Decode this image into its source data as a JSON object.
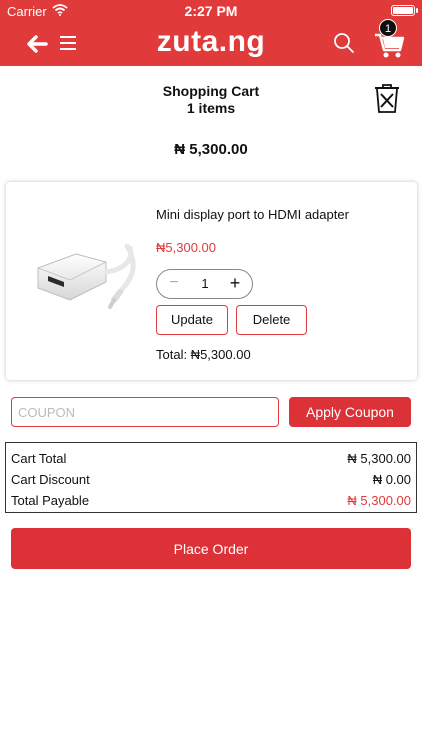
{
  "status_bar": {
    "carrier": "Carrier",
    "time": "2:27 PM"
  },
  "header": {
    "logo": "zuta.ng",
    "cart_badge": "1",
    "colors": {
      "brand": "#e03a3a",
      "badge": "#111111"
    },
    "icons": [
      "back-arrow-icon",
      "hamburger-icon",
      "search-icon",
      "cart-icon"
    ]
  },
  "cart": {
    "title": "Shopping Cart",
    "count_label": "1 items",
    "amount": "₦ 5,300.00"
  },
  "item": {
    "name": "Mini display port to HDMI adapter",
    "price": "₦5,300.00",
    "quantity": "1",
    "minus": "−",
    "plus": "+",
    "update_label": "Update",
    "delete_label": "Delete",
    "total": "Total: ₦5,300.00"
  },
  "coupon": {
    "placeholder": "COUPON",
    "apply_label": "Apply Coupon"
  },
  "summary": {
    "rows": [
      {
        "label": "Cart Total",
        "value": "₦ 5,300.00"
      },
      {
        "label": "Cart Discount",
        "value": "₦ 0.00"
      },
      {
        "label": "Total Payable",
        "value": "₦ 5,300.00"
      }
    ]
  },
  "actions": {
    "place_order": "Place Order"
  }
}
